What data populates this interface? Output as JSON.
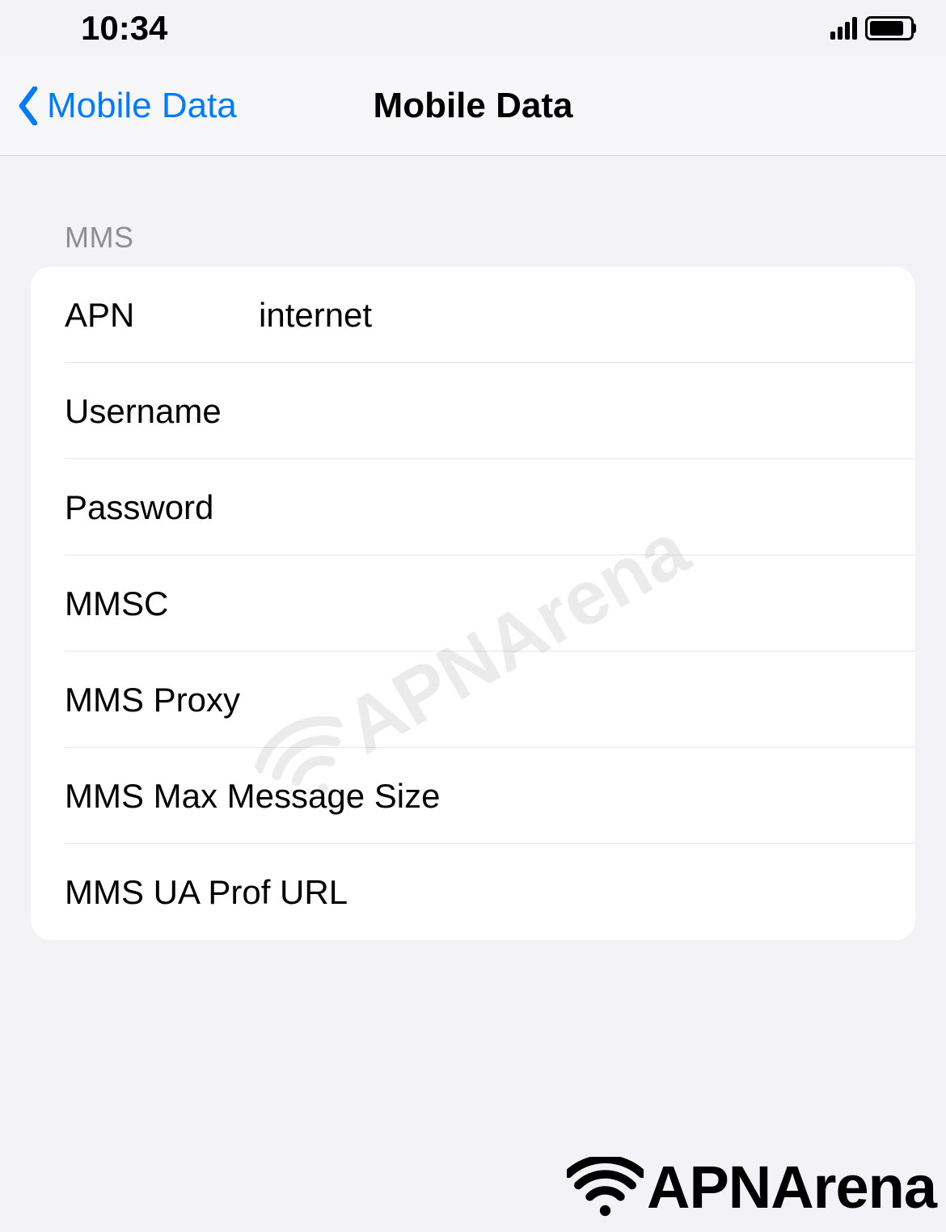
{
  "statusBar": {
    "time": "10:34"
  },
  "navBar": {
    "backLabel": "Mobile Data",
    "title": "Mobile Data"
  },
  "section": {
    "header": "MMS"
  },
  "fields": {
    "apn": {
      "label": "APN",
      "value": "internet"
    },
    "username": {
      "label": "Username",
      "value": ""
    },
    "password": {
      "label": "Password",
      "value": ""
    },
    "mmsc": {
      "label": "MMSC",
      "value": ""
    },
    "mmsProxy": {
      "label": "MMS Proxy",
      "value": ""
    },
    "mmsMaxMessageSize": {
      "label": "MMS Max Message Size",
      "value": ""
    },
    "mmsUaProfUrl": {
      "label": "MMS UA Prof URL",
      "value": ""
    }
  },
  "watermark": {
    "text": "APNArena"
  },
  "footer": {
    "brand": "APNArena"
  }
}
